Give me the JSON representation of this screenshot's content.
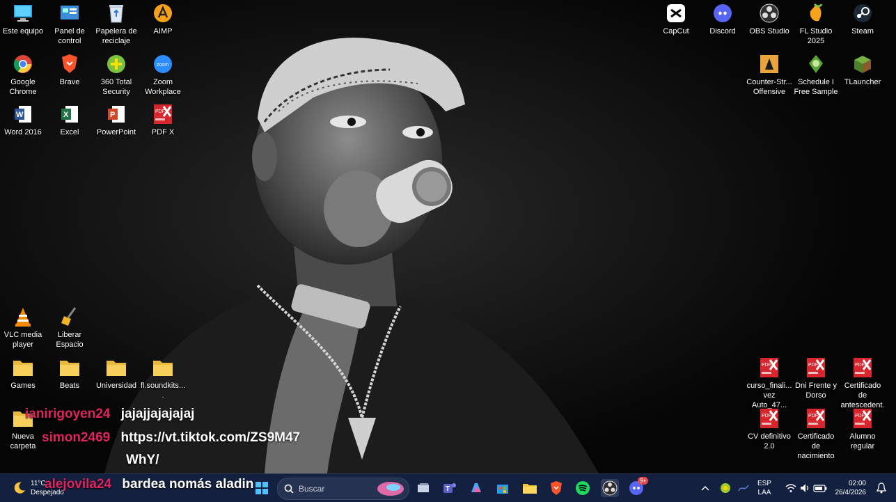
{
  "desktop": {
    "left_icons": [
      {
        "label": "Este equipo",
        "icon": "computer-icon"
      },
      {
        "label": "Panel de control",
        "icon": "control-panel-icon"
      },
      {
        "label": "Papelera de reciclaje",
        "icon": "recycle-bin-icon"
      },
      {
        "label": "AIMP",
        "icon": "aimp-icon"
      },
      {
        "label": "Google Chrome",
        "icon": "chrome-icon"
      },
      {
        "label": "Brave",
        "icon": "brave-icon"
      },
      {
        "label": "360 Total Security",
        "icon": "360-security-icon"
      },
      {
        "label": "Zoom Workplace",
        "icon": "zoom-icon"
      },
      {
        "label": "Word 2016",
        "icon": "word-icon"
      },
      {
        "label": "Excel",
        "icon": "excel-icon"
      },
      {
        "label": "PowerPoint",
        "icon": "powerpoint-icon"
      },
      {
        "label": "PDF X",
        "icon": "pdfx-icon"
      },
      {
        "label": "VLC media player",
        "icon": "vlc-icon"
      },
      {
        "label": "Liberar Espacio",
        "icon": "broom-icon"
      },
      {
        "label": "Games",
        "icon": "folder-icon"
      },
      {
        "label": "Beats",
        "icon": "folder-icon"
      },
      {
        "label": "Universidad",
        "icon": "folder-icon"
      },
      {
        "label": "fl.soundkits....",
        "icon": "folder-icon"
      },
      {
        "label": "Nueva carpeta",
        "icon": "folder-icon"
      }
    ],
    "right_icons": [
      {
        "label": "CapCut",
        "icon": "capcut-icon"
      },
      {
        "label": "Discord",
        "icon": "discord-icon"
      },
      {
        "label": "OBS Studio",
        "icon": "obs-icon"
      },
      {
        "label": "FL Studio 2025",
        "icon": "fl-studio-icon"
      },
      {
        "label": "Steam",
        "icon": "steam-icon"
      },
      {
        "label": "Counter-Str... Offensive",
        "icon": "csgo-icon"
      },
      {
        "label": "Schedule I Free Sample",
        "icon": "schedule-icon"
      },
      {
        "label": "TLauncher",
        "icon": "tlauncher-icon"
      },
      {
        "label": "curso_finali... vez Auto_47...",
        "icon": "pdf-file-icon"
      },
      {
        "label": "Dni Frente y Dorso",
        "icon": "pdf-file-icon"
      },
      {
        "label": "Certificado de antescedent...",
        "icon": "pdf-file-icon"
      },
      {
        "label": "CV definitivo 2.0",
        "icon": "pdf-file-icon"
      },
      {
        "label": "Certificado de nacimiento",
        "icon": "pdf-file-icon"
      },
      {
        "label": "Alumno regular",
        "icon": "pdf-file-icon"
      }
    ]
  },
  "chat": [
    {
      "user": "ianirigoyen24",
      "message": "jajajjajajajaj",
      "user_color": "#e0245e"
    },
    {
      "user": "simon2469",
      "message": "https://vt.tiktok.com/ZS9M47",
      "user_color": "#e0245e"
    },
    {
      "user": "",
      "message": "WhY/",
      "user_color": "#e0245e"
    },
    {
      "user": "alejovila24",
      "message": "bardea nomás aladin",
      "user_color": "#e0245e"
    }
  ],
  "taskbar": {
    "weather_temp": "11°C",
    "weather_desc": "Despejado",
    "search_placeholder": "Buscar",
    "language_top": "ESP",
    "language_bottom": "LAA",
    "time": "02:00",
    "date": "26/4/2026",
    "discord_badge": "9+",
    "pinned": [
      "widgets-icon",
      "task-view-icon",
      "teams-icon",
      "copilot-icon",
      "store-icon",
      "file-explorer-icon",
      "brave-icon",
      "spotify-icon",
      "obs-icon",
      "discord-icon"
    ]
  },
  "colors": {
    "taskbar_bg": "#13203f",
    "chat_user": "#e0245e",
    "pdf_red": "#d7262e"
  }
}
